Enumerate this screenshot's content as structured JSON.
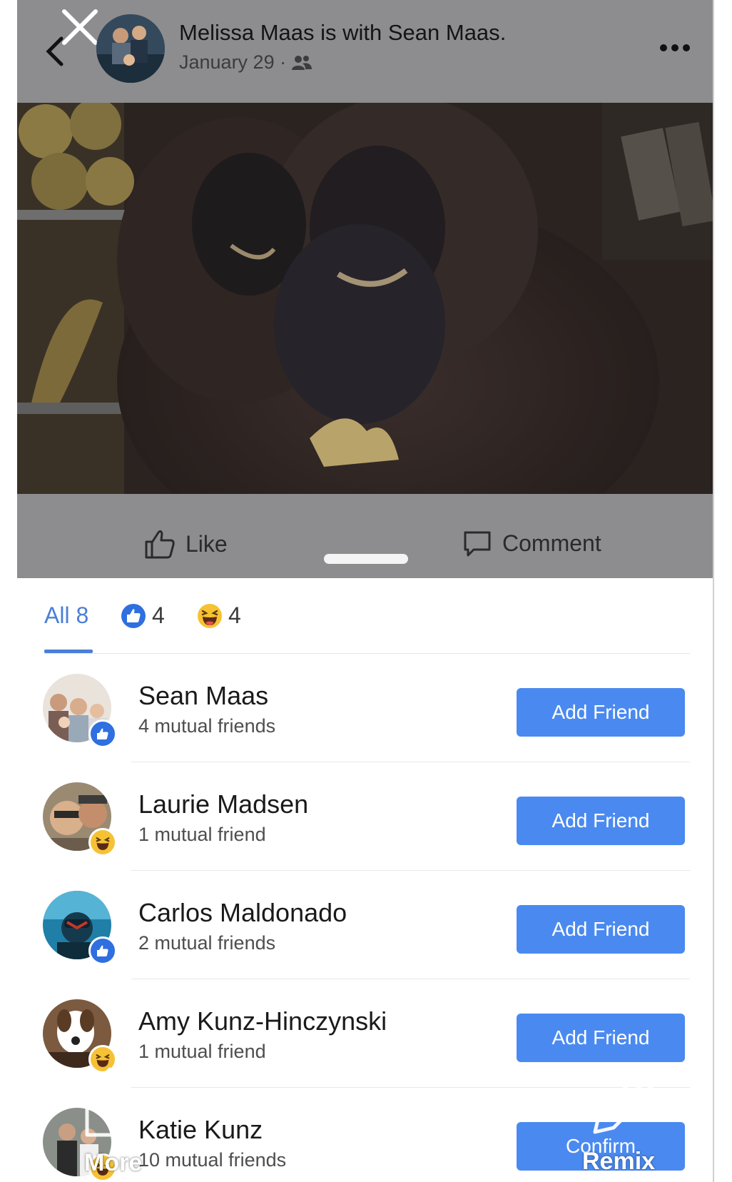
{
  "post_header": {
    "author": "Melissa Maas",
    "connector": " is with ",
    "tagged": "Sean Maas",
    "end": ".",
    "date": "January 29 ·",
    "audience_icon": "friends-icon",
    "more_icon": "more-dots-icon",
    "close_icon": "close-icon",
    "back_icon": "back-chevron-icon"
  },
  "actions": {
    "like_label": "Like",
    "comment_label": "Comment"
  },
  "tabs": {
    "all_label": "All 8",
    "like_count": "4",
    "haha_count": "4"
  },
  "reactors": [
    {
      "name": "Sean Maas",
      "mutual": "4 mutual friends",
      "button": "Add Friend",
      "reaction": "like"
    },
    {
      "name": "Laurie Madsen",
      "mutual": "1 mutual friend",
      "button": "Add Friend",
      "reaction": "haha"
    },
    {
      "name": "Carlos Maldonado",
      "mutual": "2 mutual friends",
      "button": "Add Friend",
      "reaction": "like"
    },
    {
      "name": "Amy Kunz-Hinczynski",
      "mutual": "1 mutual friend",
      "button": "Add Friend",
      "reaction": "haha"
    },
    {
      "name": "Katie Kunz",
      "mutual": "10 mutual friends",
      "button": "Confirm",
      "reaction": "haha"
    }
  ],
  "overlay": {
    "share_label": "More",
    "remix_label": "Remix"
  },
  "colors": {
    "accent": "#4a7fd8",
    "button": "#4a8af0",
    "like_badge": "#2f6fe0",
    "haha_badge": "#f6c234",
    "dim": "#8d8d8f"
  }
}
